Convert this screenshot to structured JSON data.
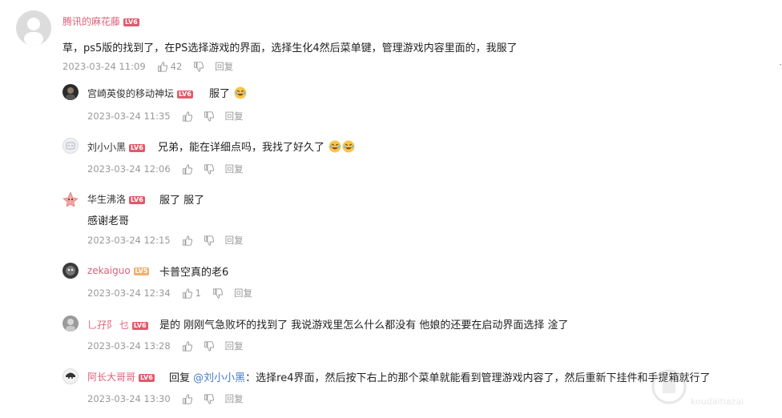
{
  "comments": [
    {
      "user": "腾讯的麻花藤",
      "badge": "LV6",
      "text": "草，ps5版的找到了，在PS选择游戏的界面，选择生化4然后菜单键，管理游戏内容里面的，我服了",
      "time": "2023-03-24 11:09",
      "likes": "42",
      "reply_label": "回复"
    },
    {
      "user": "宫崎英俊的移动神坛",
      "badge": "LV6",
      "text": "服了",
      "time": "2023-03-24 11:35",
      "reply_label": "回复"
    },
    {
      "user": "刘小小黑",
      "badge": "LV6",
      "text": "兄弟，能在详细点吗，我找了好久了",
      "time": "2023-03-24 12:06",
      "reply_label": "回复"
    },
    {
      "user": "华生沸洛",
      "badge": "LV6",
      "text_line1": "服了 服了",
      "text_line2": "感谢老哥",
      "time": "2023-03-24 12:15",
      "reply_label": "回复"
    },
    {
      "user": "zekaiguo",
      "badge": "LV5",
      "text": "卡普空真的老6",
      "time": "2023-03-24 12:34",
      "likes": "1",
      "reply_label": "回复"
    },
    {
      "user": "乚孖阝 乜",
      "badge": "LV6",
      "text": "是的 刚刚气急败坏的找到了 我说游戏里怎么什么都没有 他娘的还要在启动界面选择 淦了",
      "time": "2023-03-24 13:28",
      "reply_label": "回复"
    },
    {
      "user": "阿长大哥哥",
      "badge": "LV6",
      "reply_prefix": "回复",
      "mention": "@刘小小黑",
      "text": "：选择re4界面，然后按下右上的那个菜单就能看到管理游戏内容了，然后重新下挂件和手提箱就行了",
      "time": "2023-03-24 13:30",
      "reply_label": "回复"
    }
  ],
  "side_glyph": "·",
  "watermark": "koudaitiazai"
}
